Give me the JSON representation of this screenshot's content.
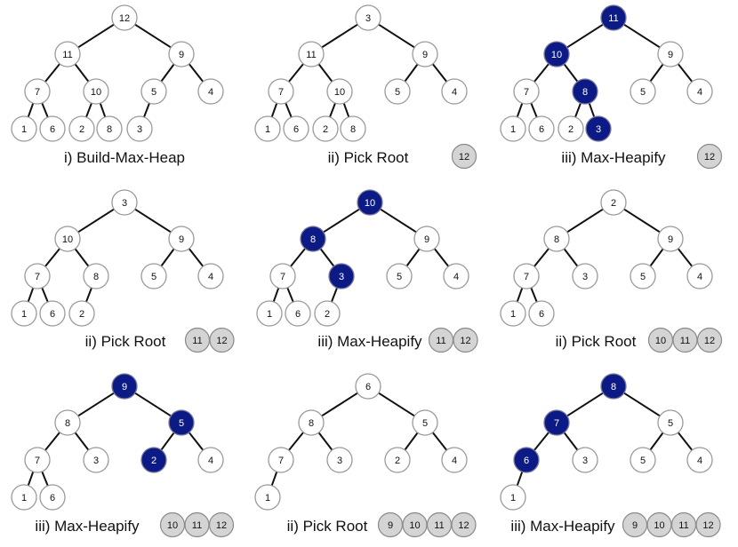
{
  "colors": {
    "highlight": "#0c1a86",
    "node_fill": "#ffffff",
    "node_stroke": "#9a9a9a",
    "sorted_fill": "#d4d4d4",
    "edge": "#111111"
  },
  "panels": [
    {
      "caption": "i) Build-Max-Heap",
      "heap": [
        12,
        11,
        9,
        7,
        10,
        5,
        4,
        1,
        6,
        2,
        8,
        3
      ],
      "highlighted_indices": [],
      "sorted": []
    },
    {
      "caption": "ii) Pick Root",
      "heap": [
        3,
        11,
        9,
        7,
        10,
        5,
        4,
        1,
        6,
        2,
        8
      ],
      "highlighted_indices": [],
      "sorted": [
        12
      ]
    },
    {
      "caption": "iii) Max-Heapify",
      "heap": [
        11,
        10,
        9,
        7,
        8,
        5,
        4,
        1,
        6,
        2,
        3
      ],
      "highlighted_indices": [
        0,
        1,
        4,
        10
      ],
      "sorted": [
        12
      ]
    },
    {
      "caption": "ii) Pick Root",
      "heap": [
        3,
        10,
        9,
        7,
        8,
        5,
        4,
        1,
        6,
        2
      ],
      "highlighted_indices": [],
      "sorted": [
        11,
        12
      ]
    },
    {
      "caption": "iii) Max-Heapify",
      "heap": [
        10,
        8,
        9,
        7,
        3,
        5,
        4,
        1,
        6,
        2
      ],
      "highlighted_indices": [
        0,
        1,
        4
      ],
      "sorted": [
        11,
        12
      ]
    },
    {
      "caption": "ii) Pick Root",
      "heap": [
        2,
        8,
        9,
        7,
        3,
        5,
        4,
        1,
        6
      ],
      "highlighted_indices": [],
      "sorted": [
        10,
        11,
        12
      ]
    },
    {
      "caption": "iii) Max-Heapify",
      "heap": [
        9,
        8,
        5,
        7,
        3,
        2,
        4,
        1,
        6
      ],
      "highlighted_indices": [
        0,
        2,
        5
      ],
      "sorted": [
        10,
        11,
        12
      ]
    },
    {
      "caption": "ii) Pick Root",
      "heap": [
        6,
        8,
        5,
        7,
        3,
        2,
        4,
        1
      ],
      "highlighted_indices": [],
      "sorted": [
        9,
        10,
        11,
        12
      ]
    },
    {
      "caption": "iii) Max-Heapify",
      "heap": [
        8,
        7,
        5,
        6,
        3,
        5,
        4,
        1
      ],
      "highlighted_indices": [
        0,
        1,
        3
      ],
      "sorted": [
        9,
        10,
        11,
        12
      ]
    }
  ]
}
